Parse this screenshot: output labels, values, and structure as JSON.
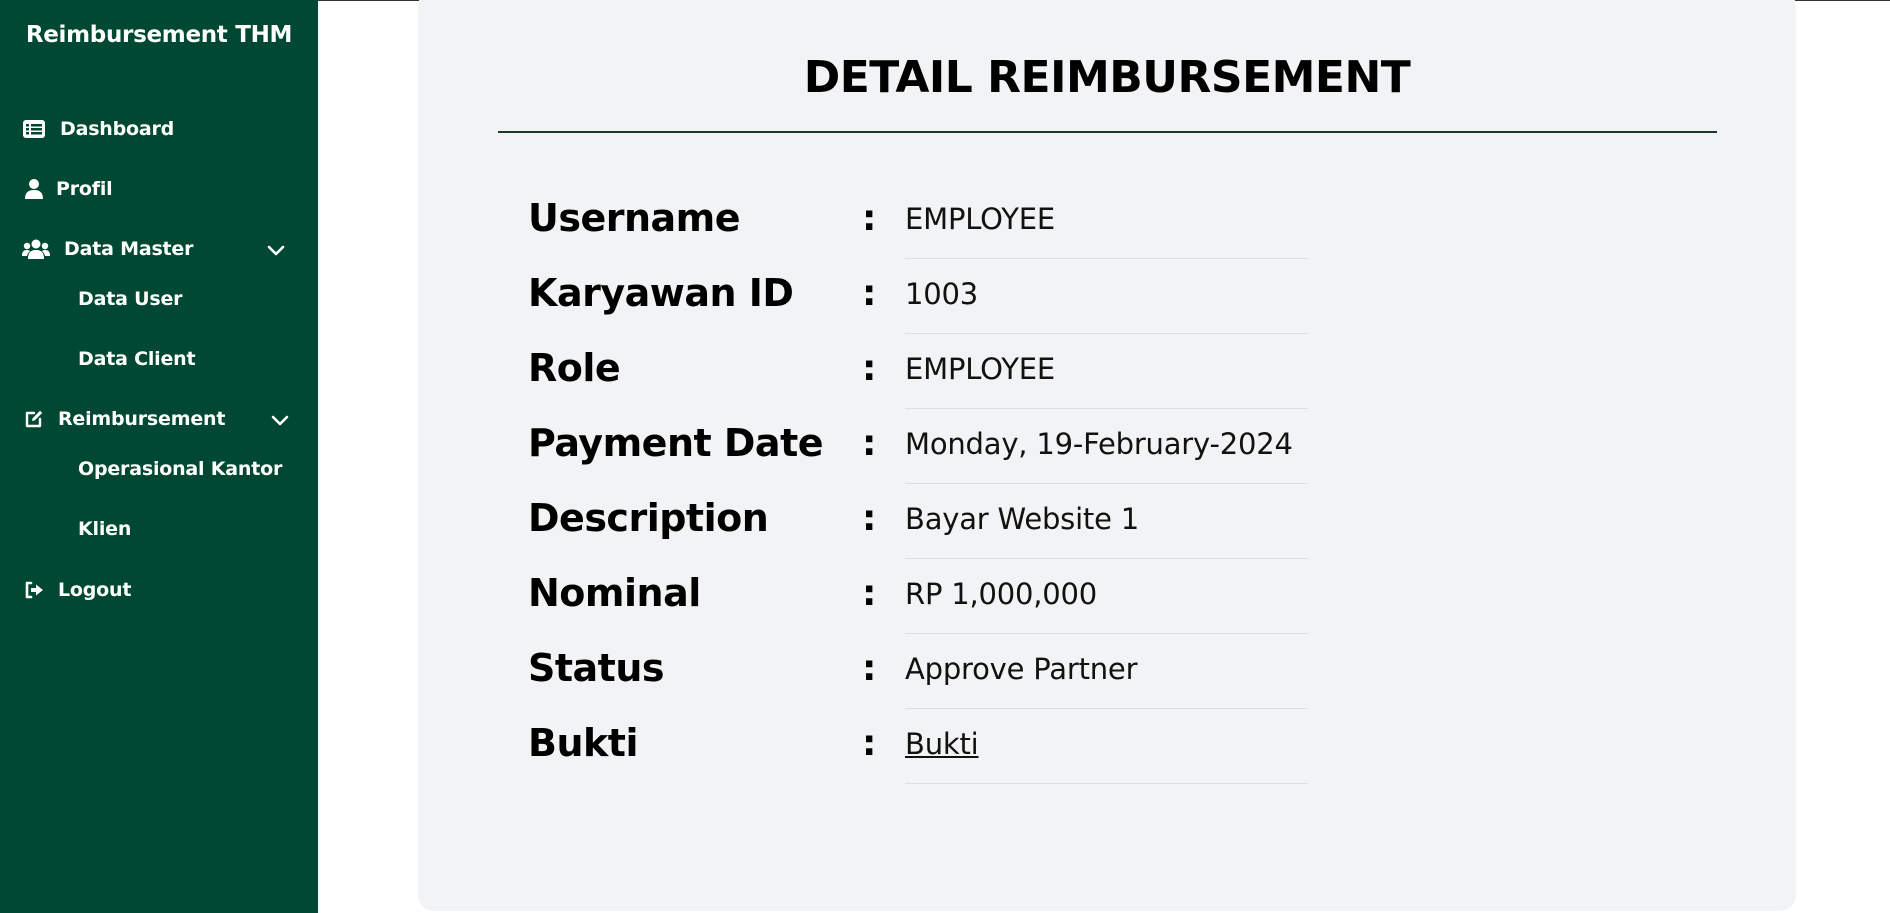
{
  "sidebar": {
    "brand": "Reimbursement THM",
    "items": {
      "dashboard": {
        "label": "Dashboard",
        "icon": "list-icon"
      },
      "profil": {
        "label": "Profil",
        "icon": "user-icon"
      },
      "data_master": {
        "label": "Data Master",
        "icon": "users-icon"
      },
      "data_user": {
        "label": "Data User"
      },
      "data_client": {
        "label": "Data Client"
      },
      "reimbursement": {
        "label": "Reimbursement",
        "icon": "edit-icon"
      },
      "operasional_kantor": {
        "label": "Operasional Kantor"
      },
      "klien": {
        "label": "Klien"
      },
      "logout": {
        "label": "Logout",
        "icon": "sign-out-icon"
      }
    }
  },
  "main": {
    "title": "DETAIL REIMBURSEMENT",
    "separator": ":",
    "rows": [
      {
        "label": "Username",
        "value": "EMPLOYEE"
      },
      {
        "label": "Karyawan ID",
        "value": "1003"
      },
      {
        "label": "Role",
        "value": "EMPLOYEE"
      },
      {
        "label": "Payment Date",
        "value": "Monday, 19-February-2024"
      },
      {
        "label": "Description",
        "value": "Bayar Website 1"
      },
      {
        "label": "Nominal",
        "value": "RP 1,000,000"
      },
      {
        "label": "Status",
        "value": "Approve Partner"
      },
      {
        "label": "Bukti",
        "value": "Bukti"
      }
    ]
  },
  "colors": {
    "sidebar_bg": "#004831",
    "card_bg": "#f2f3f5",
    "text": "#000000"
  }
}
